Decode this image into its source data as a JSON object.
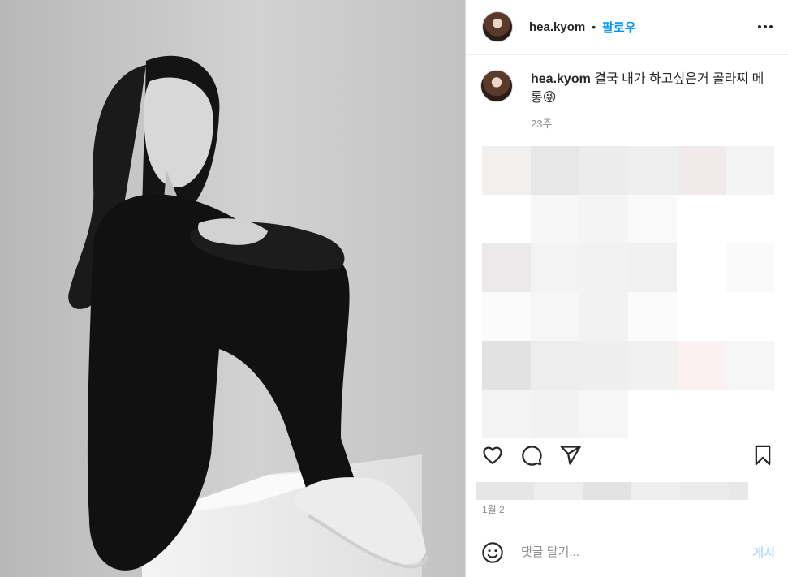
{
  "header": {
    "username": "hea.kyom",
    "separator": "•",
    "follow_label": "팔로우",
    "more_icon": "more-horizontal-icon"
  },
  "caption": {
    "username": "hea.kyom",
    "text": "결국 내가 하고싶은거 골라찌 메롱",
    "emoji": "😜",
    "time": "23주"
  },
  "actions": {
    "like_icon": "heart-icon",
    "comment_icon": "comment-icon",
    "share_icon": "paper-plane-icon",
    "save_icon": "bookmark-icon"
  },
  "post_date": "1월 2",
  "comment_box": {
    "emoji_icon": "smiley-icon",
    "placeholder": "댓글 달기...",
    "post_label": "게시"
  },
  "colors": {
    "accent": "#0095f6",
    "post_disabled": "#b2dffc",
    "secondary_text": "#8e8e8e",
    "divider": "#efefef"
  }
}
